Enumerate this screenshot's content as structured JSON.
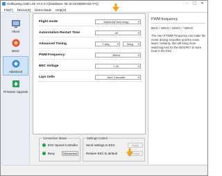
{
  "window": {
    "title": "Hobbywing USB Link V4.0.2.0    [Database: 06-15-2018(MM-DD-YY)]",
    "minimize": "–",
    "maximize": "□",
    "close": "✕"
  },
  "menu": [
    "File(F)",
    "Device(D)",
    "Demo Mode",
    "Help(H)"
  ],
  "sidebar": {
    "items": [
      {
        "label": "About",
        "icon": "about-icon",
        "active": false
      },
      {
        "label": "Basic",
        "icon": "basic-icon",
        "active": false
      },
      {
        "label": "Advanced",
        "icon": "advanced-icon",
        "active": true
      },
      {
        "label": "Firmware Upgrade",
        "icon": "firmware-upgrade-icon",
        "active": false
      }
    ]
  },
  "settings": {
    "flight_mode": {
      "label": "Flight mode",
      "value": "Airplane(Fixed wing)"
    },
    "autorotation": {
      "label": "Autorotation Restart Time",
      "value": "off"
    },
    "advanced_timing": {
      "label": "Advanced Timing",
      "value": "0 deg",
      "value2": "0deg"
    },
    "pwm_frequency": {
      "label": "PWM Frequency",
      "value": "32kHz"
    },
    "bec_voltage": {
      "label": "BEC Voltage",
      "value": "7.4V"
    },
    "lipo_cells": {
      "label": "Lipo Cells",
      "value": "Auto Calculate"
    }
  },
  "info": {
    "title": "PWM frequency",
    "options": "8KHz / 16KHz / 24KHz / *32KHz",
    "description": "The rise of PWM Frequency can make the motor driving smoother and the noise lower, certainly, this will bring more switching loss for the MOSFET & more heat to the ESC."
  },
  "connection_status": {
    "title": "Connection Status",
    "esc_label": "ESC Speed Controller",
    "busy_label": "Busy",
    "disconnect_label": "Disconnect"
  },
  "settings_control": {
    "title": "Settings Control",
    "send_label": "Send settings to ESC",
    "restore_label": "Restore ESC to default",
    "apply_label": "Apply",
    "default_label": "Default"
  },
  "colors": {
    "accent": "#3a8fd6",
    "status_green": "#19a34a",
    "arrow_orange": "#f0a21a"
  }
}
